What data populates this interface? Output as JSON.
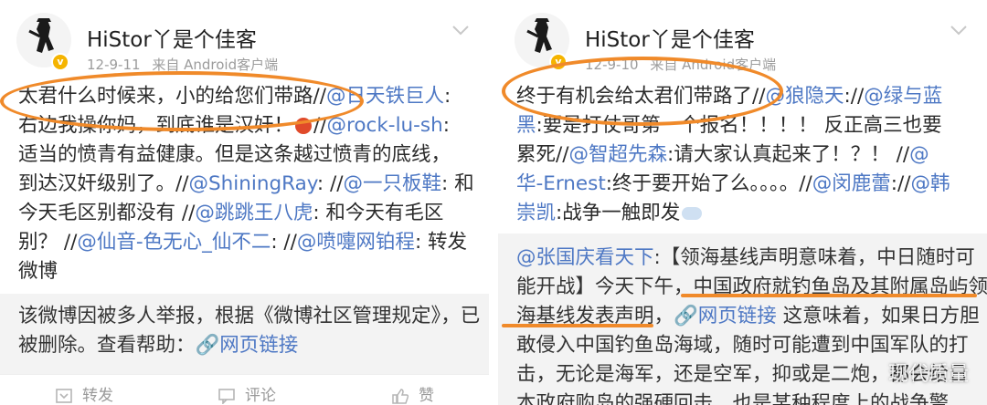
{
  "left": {
    "username": "HiStor丫是个佳客",
    "date": "12-9-11",
    "source": "来自 Android客户端",
    "lines": [
      [
        {
          "t": "太君什么时候来，小的给您们带路//"
        },
        {
          "t": "@日天铁巨人",
          "link": true
        },
        {
          "t": ":"
        }
      ],
      [
        {
          "t": "右边我操你妈，到底谁是汉奸！"
        },
        {
          "emoji": true
        },
        {
          "t": "//"
        },
        {
          "t": "@rock-lu-sh",
          "link": true
        },
        {
          "t": ":"
        }
      ],
      [
        {
          "t": "适当的愤青有益健康。但是这条越过愤青的底线，"
        }
      ],
      [
        {
          "t": "到达汉奸级别了。//"
        },
        {
          "t": "@ShiningRay",
          "link": true
        },
        {
          "t": ": //"
        },
        {
          "t": "@一只板鞋",
          "link": true
        },
        {
          "t": ": 和"
        }
      ],
      [
        {
          "t": "今天毛区别都没有 //"
        },
        {
          "t": "@跳跳王八虎",
          "link": true
        },
        {
          "t": ": 和今天有毛区"
        }
      ],
      [
        {
          "t": "别？ //"
        },
        {
          "t": "@仙音-色无心_仙不二",
          "link": true
        },
        {
          "t": ": //"
        },
        {
          "t": "@喷嚏网铂程",
          "link": true
        },
        {
          "t": ": 转发"
        }
      ],
      [
        {
          "t": "微博"
        }
      ]
    ],
    "retweet_lines": [
      [
        {
          "t": "该微博因被多人举报，根据《微博社区管理规定》，已"
        }
      ],
      [
        {
          "t": "被删除。查看帮助："
        },
        {
          "t": "🔗网页链接",
          "link": true
        }
      ]
    ],
    "actions": {
      "repost": "转发",
      "comment": "评论",
      "like": "赞"
    }
  },
  "right": {
    "username": "HiStor丫是个佳客",
    "date": "12-9-10",
    "source": "来自 Android客户端",
    "lines": [
      [
        {
          "t": "终于有机会给太君们带路了//"
        },
        {
          "t": "@狼隐天",
          "link": true
        },
        {
          "t": "://"
        },
        {
          "t": "@绿与蓝",
          "link": true
        }
      ],
      [
        {
          "t": "黑",
          "link": true
        },
        {
          "t": ":要是打仗哥第一个报名！！！！ 反正高三也要"
        }
      ],
      [
        {
          "t": "累死//"
        },
        {
          "t": "@智超先森",
          "link": true
        },
        {
          "t": ":请大家认真起来了！？！ //"
        },
        {
          "t": "@",
          "link": true
        }
      ],
      [
        {
          "t": "华-Ernest",
          "link": true
        },
        {
          "t": ":终于要开始了么。。。。//"
        },
        {
          "t": "@闵鹿蕾",
          "link": true
        },
        {
          "t": "://"
        },
        {
          "t": "@韩",
          "link": true
        }
      ],
      [
        {
          "t": "崇凯",
          "link": true
        },
        {
          "t": ":战争一触即发"
        },
        {
          "cloud": true
        }
      ]
    ],
    "retweet_lines": [
      [
        {
          "t": "@张国庆看天下",
          "link": true
        },
        {
          "t": ":【领海基线声明意味着，中日随时可"
        }
      ],
      [
        {
          "t": "能开战】今天下午，中国政府就钓鱼岛及其附属岛屿领"
        }
      ],
      [
        {
          "t": "海基线发表声明，"
        },
        {
          "t": "🔗网页链接",
          "link": true
        },
        {
          "t": " 这意味着，如果日方胆"
        }
      ],
      [
        {
          "t": "敢侵入中国钓鱼岛海域，随时可能遭到中国军队的打"
        }
      ],
      [
        {
          "t": "击，无论是海军，还是空军，抑或是二炮，都会给日"
        }
      ],
      [
        {
          "t": "本政府购岛的强硬回击，也是某种程度上的战争警"
        }
      ]
    ],
    "watermark": "现代质量"
  },
  "colors": {
    "link": "#4e78c4",
    "highlight": "#f08a2a",
    "gray": "#9c9c9c",
    "retweet_bg": "#f3f3f3"
  }
}
